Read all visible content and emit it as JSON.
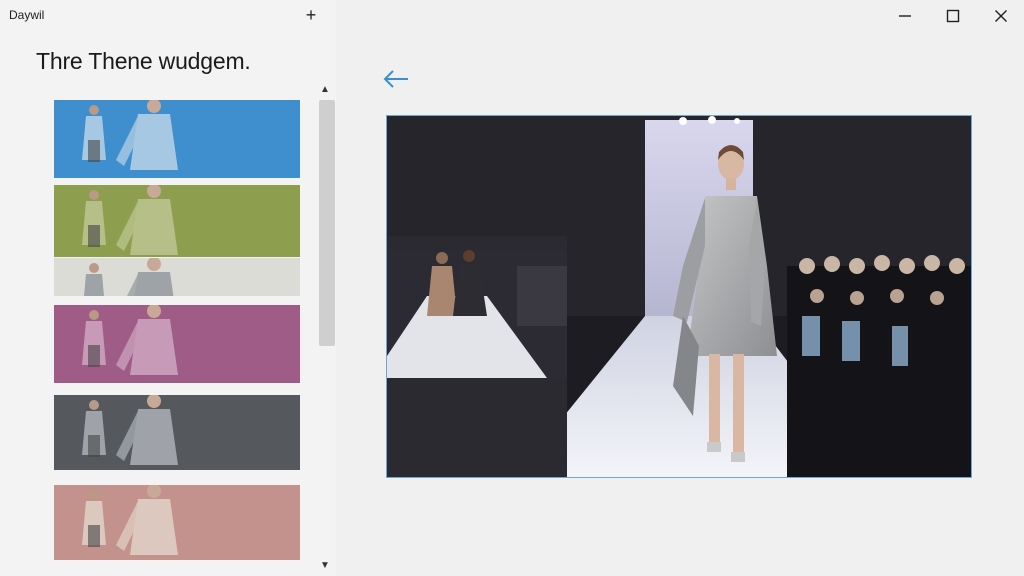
{
  "window": {
    "app_name": "Daywil",
    "controls": {
      "add": "+",
      "minimize": "—",
      "maximize": "☐",
      "close": "✕"
    }
  },
  "sidebar": {
    "title": "Thre Thene wudgem.",
    "thumbnails": [
      {
        "variant": "blue",
        "bg": "#3f8fce",
        "dress": "#a6c8e2"
      },
      {
        "variant": "green",
        "bg": "#8e9e4f",
        "dress": "#b5bf87"
      },
      {
        "variant": "light",
        "bg": "#dcdcd6",
        "dress": "#9ea3a8"
      },
      {
        "variant": "purple",
        "bg": "#9e5c86",
        "dress": "#c79ab7"
      },
      {
        "variant": "charcoal",
        "bg": "#55585d",
        "dress": "#9fa3a9"
      },
      {
        "variant": "rose",
        "bg": "#c4928c",
        "dress": "#dcc8be"
      }
    ],
    "scroll_up": "▲",
    "scroll_down": "▼",
    "scroll_position": 0.0
  },
  "main": {
    "back_icon": "back-arrow-icon",
    "photo": {
      "subject": "runway-model",
      "dress_color": "#a8a9ab",
      "runway_color": "#e8eaf2",
      "accent": "#6aa8d8"
    }
  }
}
